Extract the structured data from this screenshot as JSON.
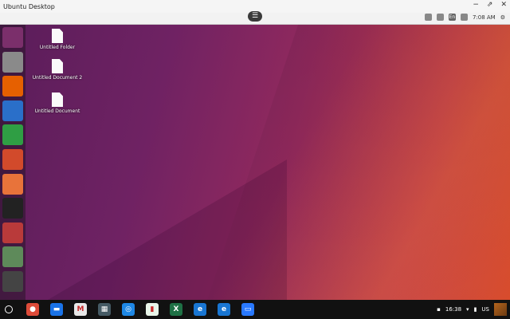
{
  "window": {
    "title": "Ubuntu Desktop",
    "controls": [
      "−",
      "⇗",
      "✕"
    ]
  },
  "panel": {
    "menu_symbol": "☰",
    "keyboard": "En",
    "time": "7:08 AM"
  },
  "desktop": {
    "icons": [
      {
        "label": "Untitled Folder"
      },
      {
        "label": "Untitled Document 2"
      },
      {
        "label": "Untitled Document"
      }
    ]
  },
  "launcher": {
    "items": [
      {
        "name": "ubuntu-dash-icon",
        "color": "#7b2f6b"
      },
      {
        "name": "files-icon",
        "color": "#8a8a8a"
      },
      {
        "name": "firefox-icon",
        "color": "#e66000"
      },
      {
        "name": "libreoffice-writer-icon",
        "color": "#2a6fc9"
      },
      {
        "name": "libreoffice-calc-icon",
        "color": "#2f9e44"
      },
      {
        "name": "libreoffice-impress-icon",
        "color": "#d24a2b"
      },
      {
        "name": "software-center-icon",
        "color": "#e8733a"
      },
      {
        "name": "amazon-icon",
        "color": "#222222"
      },
      {
        "name": "system-settings-icon",
        "color": "#b93a3a"
      },
      {
        "name": "help-icon",
        "color": "#5e8a5a"
      },
      {
        "name": "usb-drive-icon",
        "color": "#444444"
      }
    ]
  },
  "taskbar": {
    "apps": [
      {
        "name": "chrome-icon",
        "color": "#dd4b39",
        "glyph": "●"
      },
      {
        "name": "files-app-icon",
        "color": "#1a73e8",
        "glyph": "▬"
      },
      {
        "name": "gmail-icon",
        "color": "#e8e8e8",
        "glyph": "M"
      },
      {
        "name": "calculator-icon",
        "color": "#455a64",
        "glyph": "▦"
      },
      {
        "name": "app-circle-icon",
        "color": "#1e88e5",
        "glyph": "◎"
      },
      {
        "name": "sheets-chart-icon",
        "color": "#e8f5e9",
        "glyph": "▮"
      },
      {
        "name": "excel-icon",
        "color": "#1e7145",
        "glyph": "X"
      },
      {
        "name": "ie-icon-1",
        "color": "#1976d2",
        "glyph": "e"
      },
      {
        "name": "ie-icon-2",
        "color": "#1976d2",
        "glyph": "e"
      },
      {
        "name": "remote-desktop-icon",
        "color": "#2979ff",
        "glyph": "▭"
      }
    ],
    "tray": {
      "clock": "16:38",
      "locale": "US"
    }
  }
}
